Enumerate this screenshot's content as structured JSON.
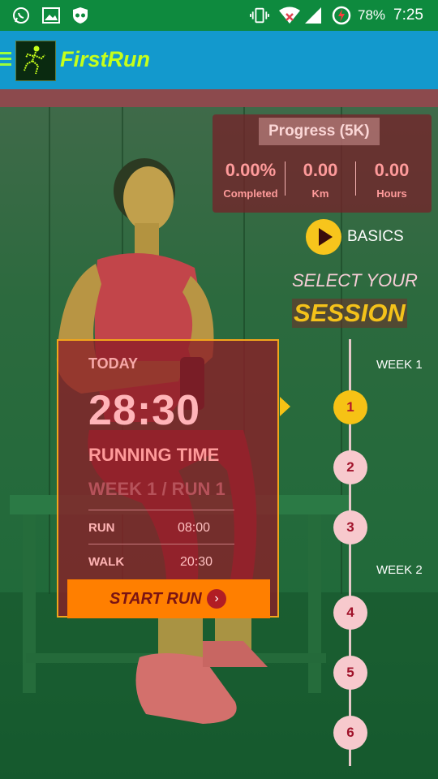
{
  "status_bar": {
    "icons": [
      "whatsapp-icon",
      "gallery-icon",
      "incognito-icon"
    ],
    "right_icons": [
      "vibrate-icon",
      "wifi-icon",
      "signal-icon",
      "battery-charging-icon"
    ],
    "battery": "78%",
    "time": "7:25"
  },
  "app_bar": {
    "title": "FirstRun",
    "menu_icon": "hamburger-icon",
    "logo_icon": "runner-logo-icon"
  },
  "progress": {
    "title": "Progress (5K)",
    "stats": [
      {
        "value": "0.00%",
        "label": "Completed"
      },
      {
        "value": "0.00",
        "label": "Km"
      },
      {
        "value": "0.00",
        "label": "Hours"
      }
    ]
  },
  "basics": {
    "label": "BASICS",
    "icon": "play-icon"
  },
  "heading": {
    "line1": "SELECT YOUR",
    "line2": "SESSION"
  },
  "card": {
    "day_label": "TODAY",
    "time": "28:30",
    "time_label": "RUNNING TIME",
    "session": "WEEK 1 / RUN 1",
    "rows": [
      {
        "label": "RUN",
        "value": "08:00"
      },
      {
        "label": "WALK",
        "value": "20:30"
      }
    ],
    "cta": "START RUN"
  },
  "timeline": {
    "weeks": [
      "WEEK 1",
      "WEEK 2"
    ],
    "sessions": [
      "1",
      "2",
      "3",
      "4",
      "5",
      "6"
    ],
    "active_index": 0
  },
  "colors": {
    "status_bar": "#0e8a3e",
    "app_bar": "#1399cd",
    "title": "#c6ff1a",
    "accent_yellow": "#f6c215",
    "cta_orange": "#ff7f00"
  }
}
